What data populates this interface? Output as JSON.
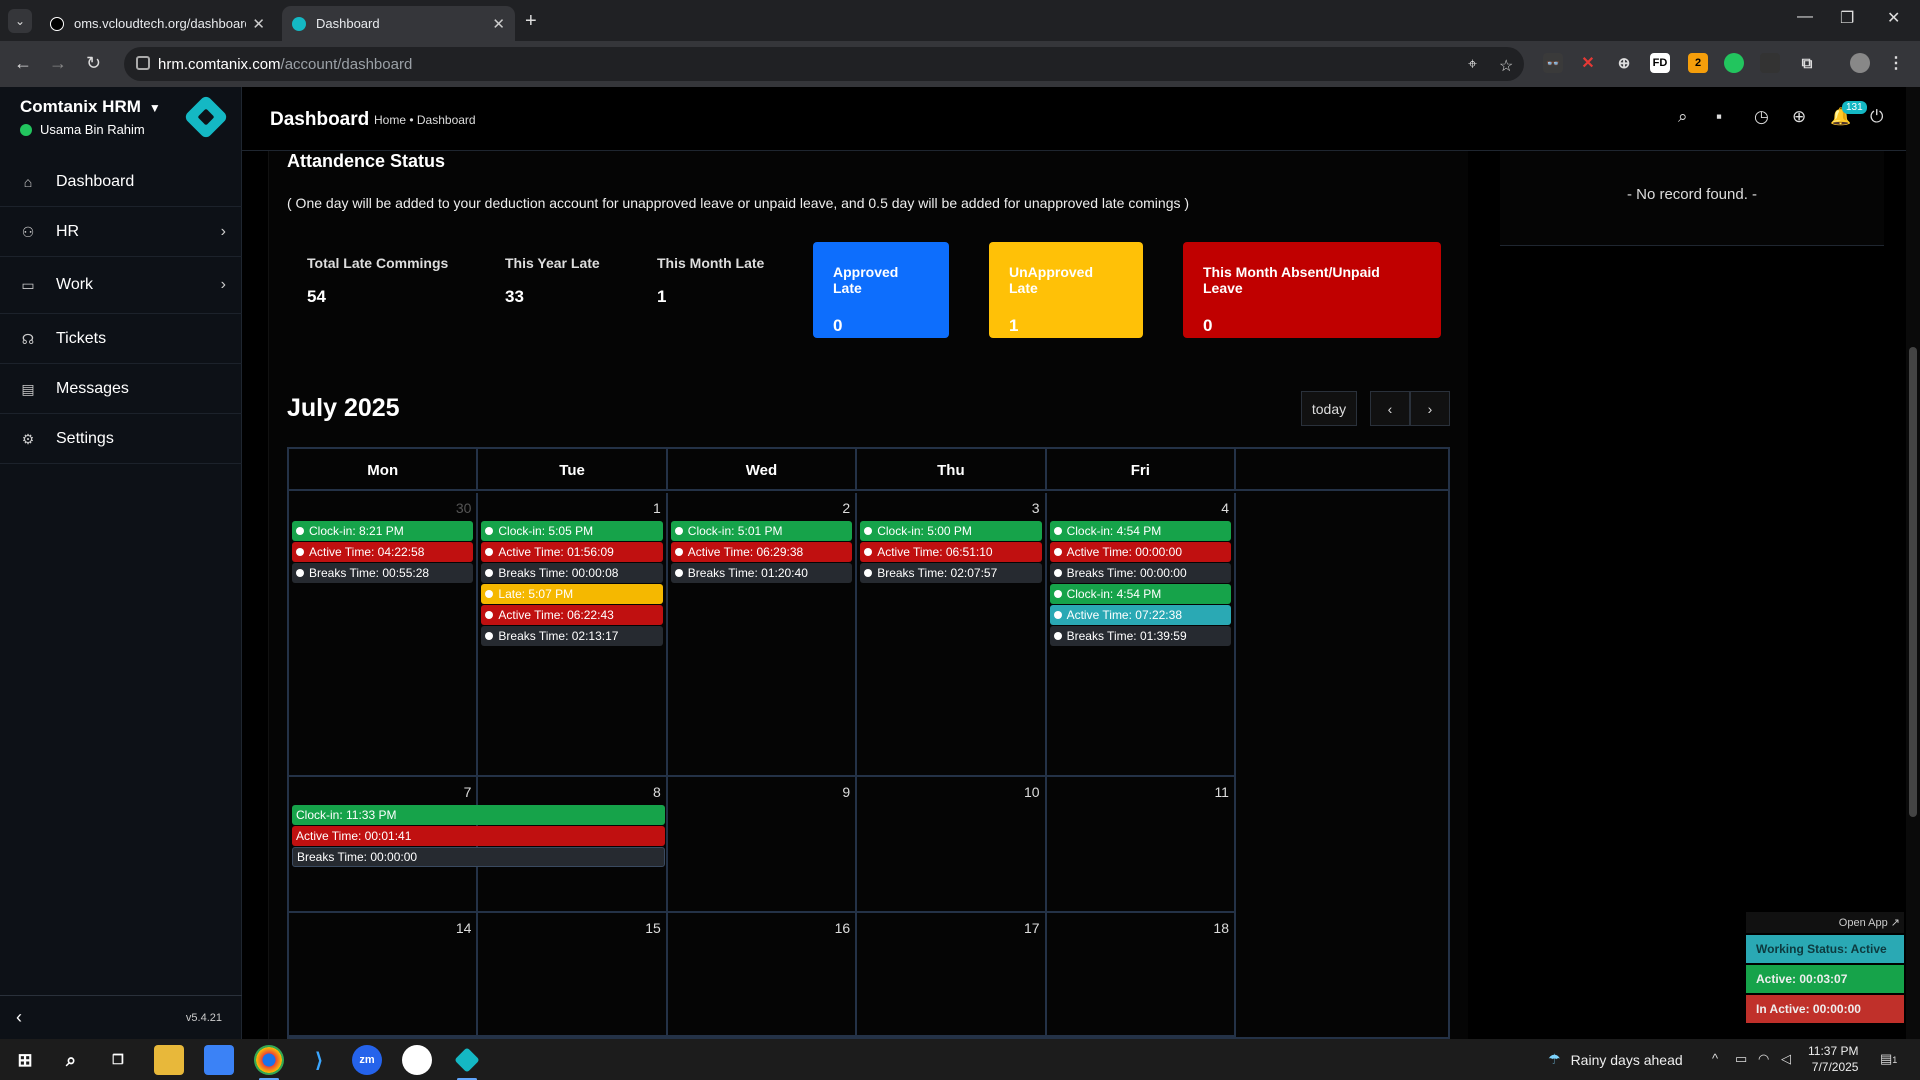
{
  "browser": {
    "tabs": [
      {
        "title": "oms.vcloudtech.org/dashboard",
        "active": false
      },
      {
        "title": "Dashboard",
        "active": true
      }
    ],
    "url_host": "hrm.comtanix.com",
    "url_path": "/account/dashboard"
  },
  "sidebar": {
    "brand": "Comtanix HRM",
    "user": "Usama Bin Rahim",
    "items": [
      {
        "label": "Dashboard",
        "icon": "home-icon"
      },
      {
        "label": "HR",
        "icon": "users-icon",
        "has_children": true
      },
      {
        "label": "Work",
        "icon": "briefcase-icon",
        "has_children": true
      },
      {
        "label": "Tickets",
        "icon": "headset-icon"
      },
      {
        "label": "Messages",
        "icon": "message-icon"
      },
      {
        "label": "Settings",
        "icon": "gear-icon"
      }
    ],
    "version": "v5.4.21"
  },
  "topbar": {
    "title": "Dashboard",
    "breadcrumb": "Home • Dashboard",
    "notification_count": "131"
  },
  "right_panel": {
    "no_record": "- No record found. -"
  },
  "attendance": {
    "title": "Attandence Status",
    "note": "( One day will be added to your deduction account for unapproved leave or unpaid leave, and 0.5 day will be added for unapproved late comings )",
    "stats": [
      {
        "label": "Total Late Commings",
        "value": "54"
      },
      {
        "label": "This Year Late",
        "value": "33"
      },
      {
        "label": "This Month Late",
        "value": "1"
      }
    ],
    "cards": [
      {
        "label": "Approved Late",
        "value": "0",
        "color": "#0d6efd"
      },
      {
        "label": "UnApproved Late",
        "value": "1",
        "color": "#ffc107"
      },
      {
        "label": "This Month Absent/Unpaid Leave",
        "value": "0",
        "color": "#c00000"
      }
    ]
  },
  "calendar": {
    "title": "July 2025",
    "today_label": "today",
    "days_of_week": [
      "Mon",
      "Tue",
      "Wed",
      "Thu",
      "Fri"
    ],
    "weeks": [
      {
        "days": [
          {
            "num": "30",
            "muted": true,
            "events": [
              {
                "text": "Clock-in: 8:21 PM",
                "color": "green"
              },
              {
                "text": "Active Time: 04:22:58",
                "color": "red"
              },
              {
                "text": "Breaks Time: 00:55:28",
                "color": "gray"
              }
            ]
          },
          {
            "num": "1",
            "events": [
              {
                "text": "Clock-in: 5:05 PM",
                "color": "green"
              },
              {
                "text": "Active Time: 01:56:09",
                "color": "red"
              },
              {
                "text": "Breaks Time: 00:00:08",
                "color": "gray"
              },
              {
                "text": "Late: 5:07 PM",
                "color": "yellow"
              },
              {
                "text": "Active Time: 06:22:43",
                "color": "red"
              },
              {
                "text": "Breaks Time: 02:13:17",
                "color": "gray"
              }
            ]
          },
          {
            "num": "2",
            "events": [
              {
                "text": "Clock-in: 5:01 PM",
                "color": "green"
              },
              {
                "text": "Active Time: 06:29:38",
                "color": "red"
              },
              {
                "text": "Breaks Time: 01:20:40",
                "color": "gray"
              }
            ]
          },
          {
            "num": "3",
            "events": [
              {
                "text": "Clock-in: 5:00 PM",
                "color": "green"
              },
              {
                "text": "Active Time: 06:51:10",
                "color": "red"
              },
              {
                "text": "Breaks Time: 02:07:57",
                "color": "gray"
              }
            ]
          },
          {
            "num": "4",
            "events": [
              {
                "text": "Clock-in: 4:54 PM",
                "color": "green"
              },
              {
                "text": "Active Time: 00:00:00",
                "color": "red"
              },
              {
                "text": "Breaks Time: 00:00:00",
                "color": "gray"
              },
              {
                "text": "Clock-in: 4:54 PM",
                "color": "green"
              },
              {
                "text": "Active Time: 07:22:38",
                "color": "teal"
              },
              {
                "text": "Breaks Time: 01:39:59",
                "color": "gray"
              }
            ]
          }
        ]
      },
      {
        "days": [
          {
            "num": "7"
          },
          {
            "num": "8"
          },
          {
            "num": "9"
          },
          {
            "num": "10"
          },
          {
            "num": "11"
          }
        ],
        "spanning_events": [
          {
            "text": "Clock-in: 11:33 PM",
            "color": "green"
          },
          {
            "text": "Active Time: 00:01:41",
            "color": "red"
          },
          {
            "text": "Breaks Time: 00:00:00",
            "color": "gray"
          }
        ]
      },
      {
        "days": [
          {
            "num": "14"
          },
          {
            "num": "15"
          },
          {
            "num": "16"
          },
          {
            "num": "17"
          },
          {
            "num": "18"
          }
        ]
      }
    ]
  },
  "widget": {
    "open_app": "Open App ↗",
    "working_status": "Working Status: Active",
    "active": "Active: 00:03:07",
    "inactive": "In Active: 00:00:00"
  },
  "taskbar": {
    "weather": "Rainy days ahead",
    "time": "11:37 PM",
    "date": "7/7/2025",
    "notif_count": "1"
  }
}
